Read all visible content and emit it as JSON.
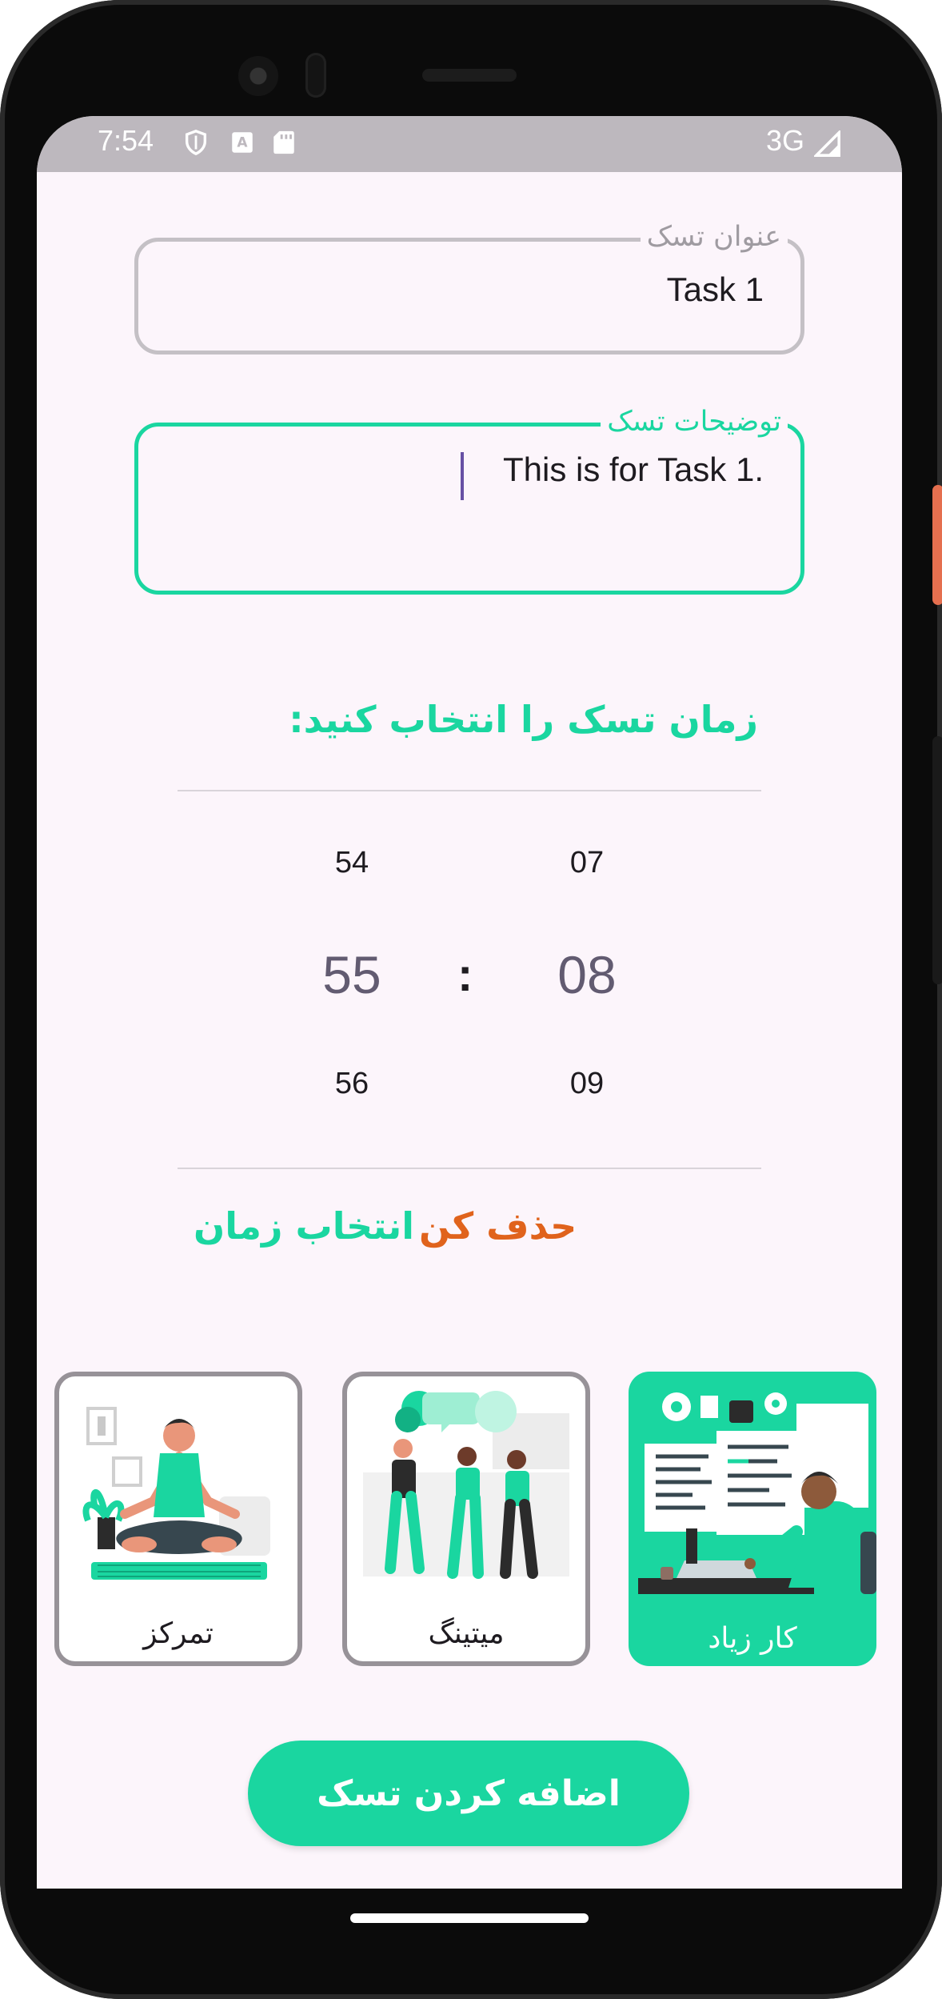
{
  "status_bar": {
    "time": "7:54",
    "network": "3G",
    "icons": [
      "shield-icon",
      "keyboard-a-icon",
      "sd-card-icon",
      "signal-icon"
    ]
  },
  "form": {
    "title_field": {
      "label": "عنوان تسک",
      "value": "Task 1"
    },
    "description_field": {
      "label": "توضیحات تسک",
      "value": "This is for Task 1."
    }
  },
  "time_picker": {
    "title": "زمان تسک را انتخاب کنید:",
    "minutes": {
      "prev": "54",
      "current": "55",
      "next": "56"
    },
    "separator": ":",
    "hours": {
      "prev": "07",
      "current": "08",
      "next": "09"
    }
  },
  "actions": {
    "delete_label": "حذف کن",
    "select_time_label": "انتخاب زمان"
  },
  "categories": [
    {
      "label": "تمرکز",
      "selected": false,
      "icon": "meditation-illustration"
    },
    {
      "label": "میتینگ",
      "selected": false,
      "icon": "meeting-illustration"
    },
    {
      "label": "کار زیاد",
      "selected": true,
      "icon": "busy-work-illustration"
    }
  ],
  "submit_label": "اضافه کردن تسک",
  "colors": {
    "accent": "#1ad6a0",
    "danger": "#e0631c",
    "screen_bg": "#fcf5fb",
    "text": "#1e1b20",
    "muted": "#979298"
  }
}
